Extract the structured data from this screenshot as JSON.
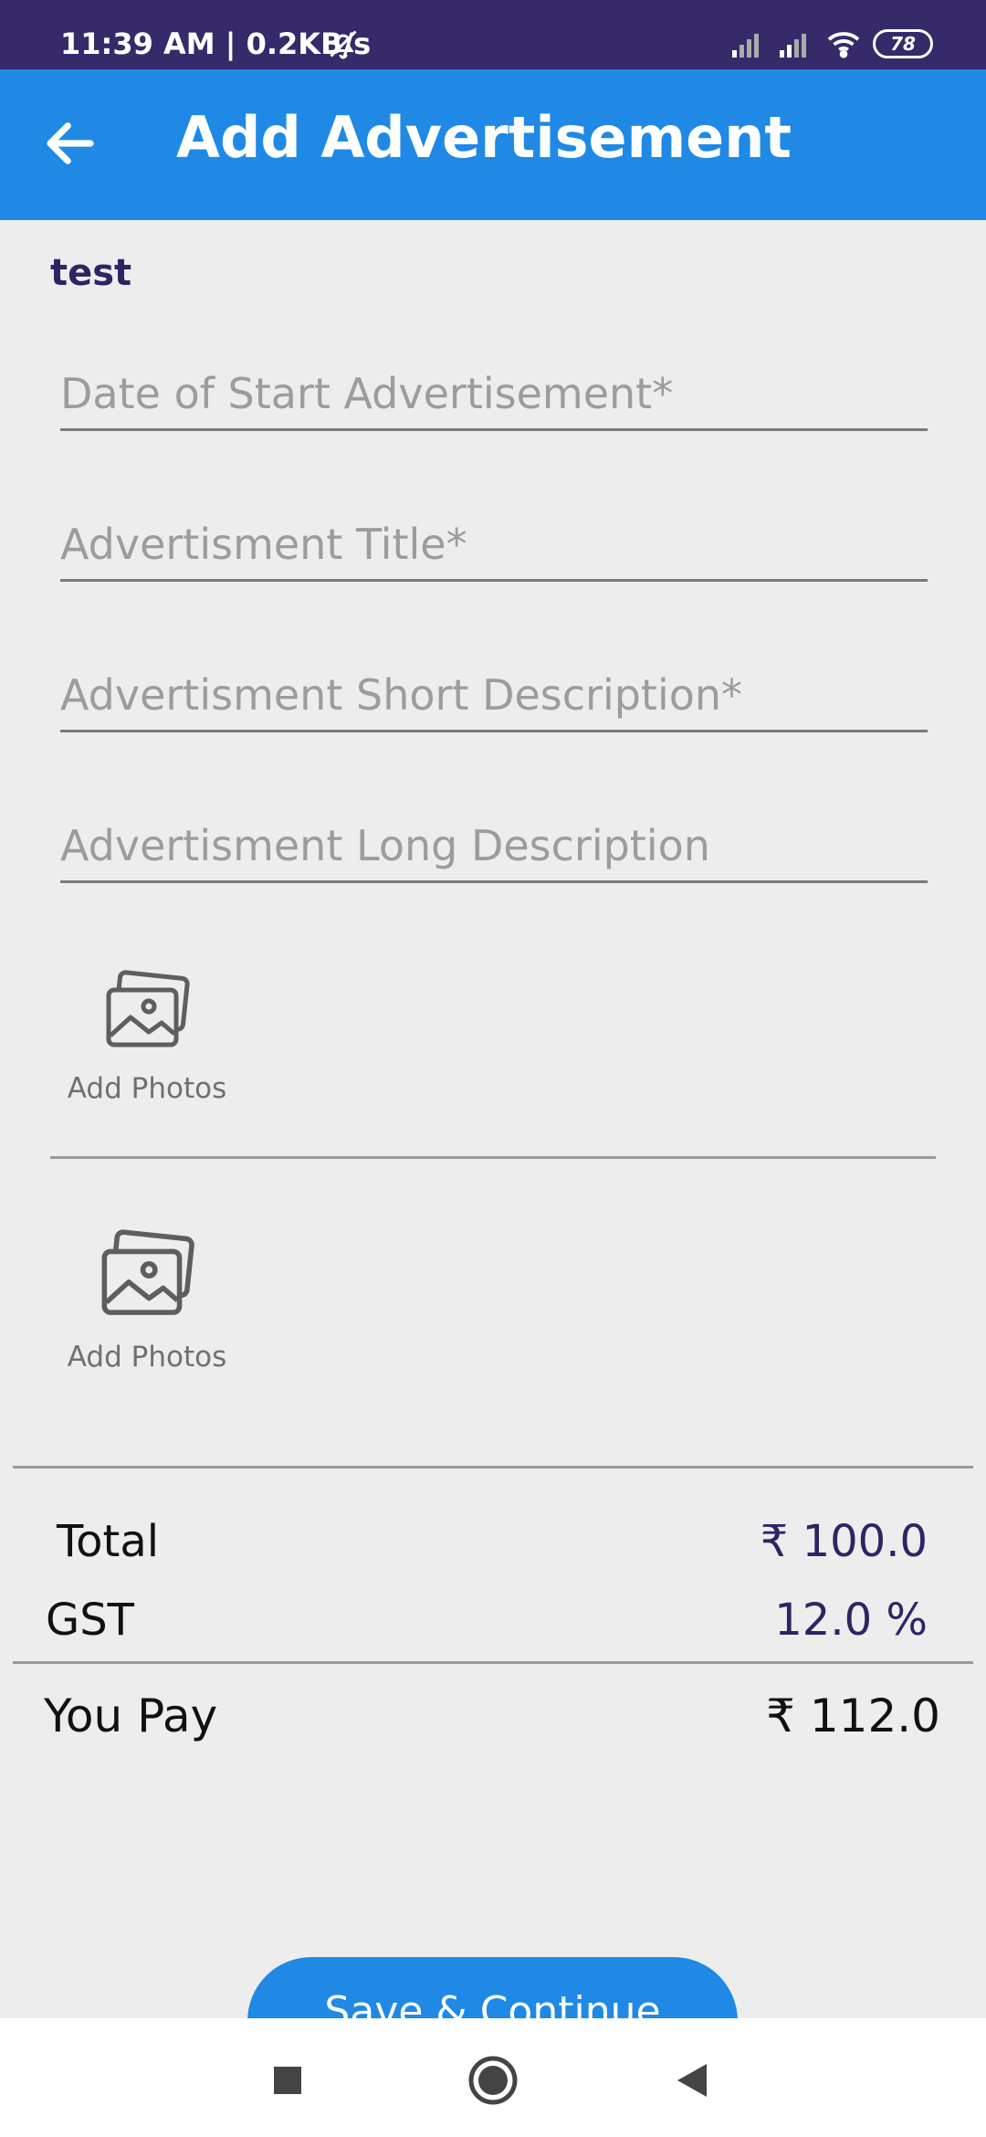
{
  "status_bar": {
    "time_speed": "11:39 AM | 0.2KB/s",
    "battery": "78"
  },
  "app_bar": {
    "title": "Add Advertisement"
  },
  "form": {
    "user_label": "test",
    "start_date_placeholder": "Date of Start Advertisement*",
    "title_placeholder": "Advertisment Title*",
    "short_desc_placeholder": "Advertisment Short Description*",
    "long_desc_placeholder": "Advertisment Long Description",
    "add_photos_1": "Add Photos",
    "add_photos_2": "Add Photos"
  },
  "summary": {
    "total_label": "Total",
    "total_value": "₹ 100.0",
    "gst_label": "GST",
    "gst_value": "12.0 %",
    "you_pay_label": "You Pay",
    "you_pay_value": "₹ 112.0"
  },
  "actions": {
    "save_label": "Save & Continue"
  },
  "colors": {
    "status_bar": "#362a6b",
    "app_bar": "#1f89e5",
    "accent_text": "#2d2563",
    "background": "#ededed"
  },
  "icons": {
    "back": "arrow-left-icon",
    "bell_off": "bell-off-icon",
    "photos": "image-stack-icon",
    "nav_recent": "square-icon",
    "nav_home": "circle-icon",
    "nav_back": "triangle-left-icon"
  }
}
